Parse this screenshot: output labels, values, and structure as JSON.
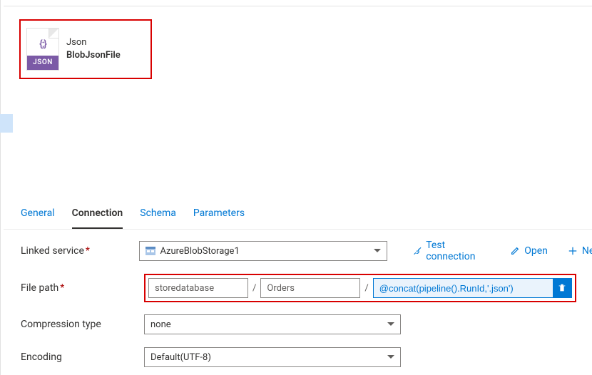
{
  "dataset": {
    "type_label": "Json",
    "name": "BlobJsonFile",
    "icon_braces": "{;}",
    "icon_band": "JSON"
  },
  "tabs": {
    "general": "General",
    "connection": "Connection",
    "schema": "Schema",
    "parameters": "Parameters",
    "active": "connection"
  },
  "form": {
    "linked_service": {
      "label": "Linked service",
      "value": "AzureBlobStorage1",
      "actions": {
        "test": "Test connection",
        "open": "Open",
        "new": "New"
      }
    },
    "file_path": {
      "label": "File path",
      "container": "storedatabase",
      "folder": "Orders",
      "expression": "@concat(pipeline().RunId,'.json')"
    },
    "compression": {
      "label": "Compression type",
      "value": "none"
    },
    "encoding": {
      "label": "Encoding",
      "value": "Default(UTF-8)"
    }
  }
}
